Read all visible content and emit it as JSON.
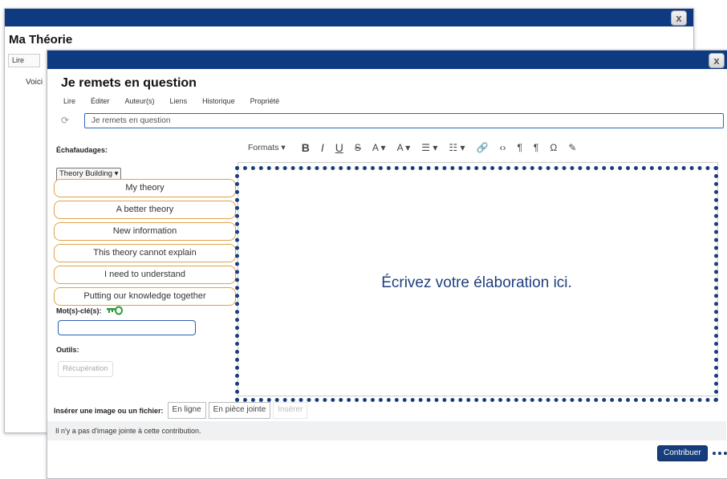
{
  "back_window": {
    "title": "Ma Théorie",
    "tab": "Lire",
    "body_text": "Voici",
    "close": "x"
  },
  "front_window": {
    "close": "x",
    "title": "Je remets en question",
    "tabs": [
      "Lire",
      "Éditer",
      "Auteur(s)",
      "Liens",
      "Historique",
      "Propriété"
    ],
    "title_field_value": "Je remets en question",
    "scaffolds_label": "Échafaudages:",
    "scaffold_select": "Theory Building ▾",
    "scaffolds": [
      "My theory",
      "A better theory",
      "New information",
      "This theory cannot explain",
      "I need to understand",
      "Putting our knowledge together"
    ],
    "keywords_label": "Mot(s)-clé(s):",
    "tools_label": "Outils:",
    "recovery_button": "Récupération",
    "toolbar": {
      "formats": "Formats ▾",
      "bold": "B",
      "italic": "I",
      "underline": "U",
      "strike": "S",
      "font_color": "A ▾",
      "highlight": "A ▾",
      "bullets": "☰ ▾",
      "numbers": "☷ ▾",
      "link": "🔗",
      "code": "‹›",
      "ltr": "¶",
      "rtl": "¶",
      "special_char": "Ω",
      "edit": "✎"
    },
    "insert_label": "Insérer une image ou un fichier:",
    "insert_buttons": [
      "En ligne",
      "En pièce jointe",
      "Insérer"
    ],
    "attachment_text": "Il n'y a pas d'image jointe à cette contribution.",
    "contribute_button": "Contribuer"
  },
  "annotation": {
    "placeholder": "Écrivez votre élaboration ici.",
    "accent_color": "#1a3d7c"
  },
  "colors": {
    "titlebar": "#0e3a82",
    "scaffold_border": "#e0a34a",
    "contribute_bg": "#163d7c"
  }
}
